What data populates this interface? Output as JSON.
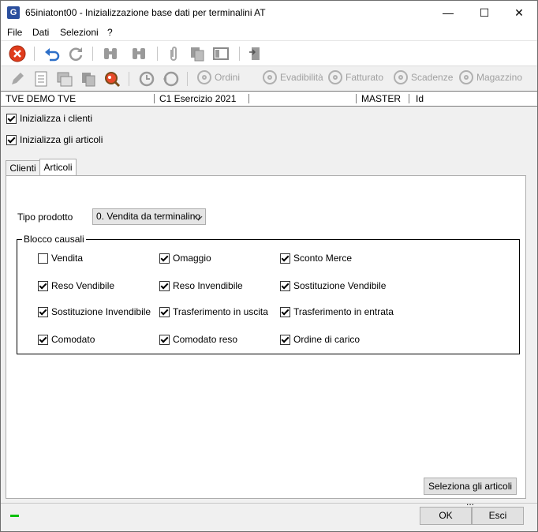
{
  "window": {
    "title": "65iniatont00 - Inizializzazione base dati per terminalini AT",
    "app_icon": "G",
    "minimize": "—",
    "maximize": "☐",
    "close": "✕"
  },
  "menu": [
    "File",
    "Dati",
    "Selezioni",
    "?"
  ],
  "toolbar2_buttons": [
    "Ordini",
    "Evadibilità",
    "Fatturato",
    "Scadenze",
    "Magazzino"
  ],
  "infobar": {
    "company": "TVE DEMO TVE",
    "year": "C1 Esercizio 2021",
    "user": "MASTER",
    "field": "Id"
  },
  "checks_top": [
    {
      "label": "Inizializza i clienti",
      "checked": true
    },
    {
      "label": "Inizializza gli articoli",
      "checked": true
    }
  ],
  "tabs": [
    "Clienti",
    "Articoli"
  ],
  "active_tab": "Articoli",
  "tipo_prodotto": {
    "label": "Tipo prodotto",
    "value": "0. Vendita da terminalino"
  },
  "blocco_causali": {
    "title": "Blocco causali",
    "items": [
      {
        "label": "Vendita",
        "checked": false
      },
      {
        "label": "Omaggio",
        "checked": true
      },
      {
        "label": "Sconto Merce",
        "checked": true
      },
      {
        "label": "Reso Vendibile",
        "checked": true
      },
      {
        "label": "Reso Invendibile",
        "checked": true
      },
      {
        "label": "Sostituzione Vendibile",
        "checked": true
      },
      {
        "label": "Sostituzione Invendibile",
        "checked": true
      },
      {
        "label": "Trasferimento in uscita",
        "checked": true
      },
      {
        "label": "Trasferimento in entrata",
        "checked": true
      },
      {
        "label": "Comodato",
        "checked": true
      },
      {
        "label": "Comodato reso",
        "checked": true
      },
      {
        "label": "Ordine di carico",
        "checked": true
      }
    ]
  },
  "buttons": {
    "select_articles": "Seleziona gli articoli ...",
    "ok": "OK",
    "exit": "Esci"
  },
  "colors": {
    "status_led": "#00c000",
    "cancel_icon": "#e03c1c",
    "undo_icon": "#2d6fc8"
  }
}
